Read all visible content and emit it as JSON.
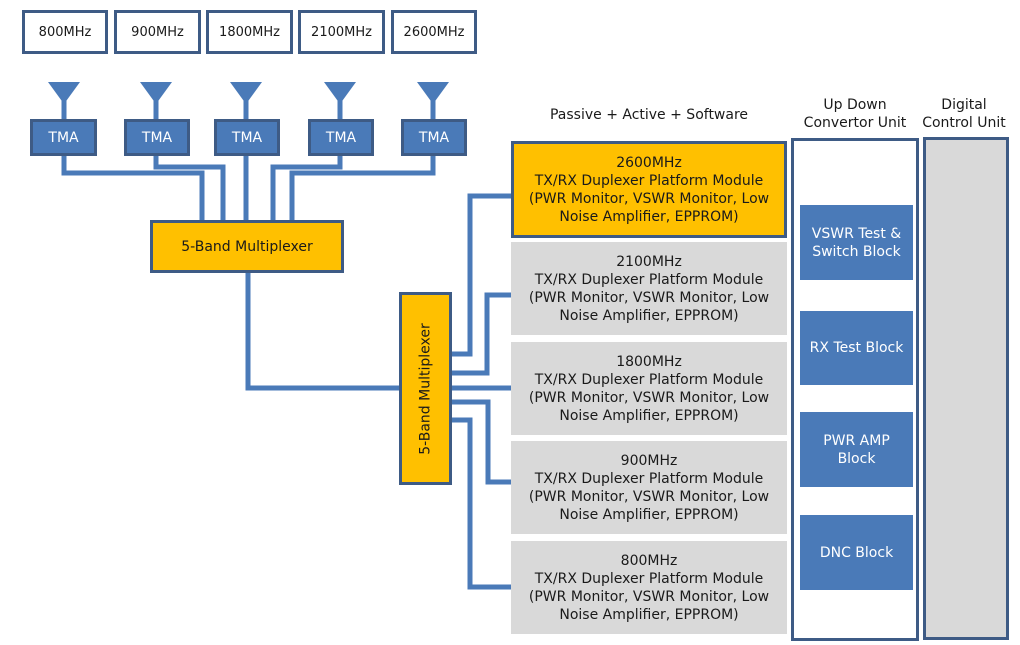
{
  "bands": [
    "800MHz",
    "900MHz",
    "1800MHz",
    "2100MHz",
    "2600MHz"
  ],
  "tma_label": "TMA",
  "multiplexer_top": "5-Band Multiplexer",
  "multiplexer_vertical": "5-Band Multiplexer",
  "section_header": "Passive + Active + Software",
  "modules": [
    {
      "freq": "2600MHz",
      "title": "TX/RX Duplexer Platform Module",
      "line1": "(PWR Monitor, VSWR Monitor, Low",
      "line2": "Noise Amplifier, EPPROM)",
      "highlight": true
    },
    {
      "freq": "2100MHz",
      "title": "TX/RX Duplexer Platform Module",
      "line1": "(PWR Monitor, VSWR Monitor, Low",
      "line2": "Noise Amplifier, EPPROM)",
      "highlight": false
    },
    {
      "freq": "1800MHz",
      "title": "TX/RX Duplexer Platform Module",
      "line1": "(PWR Monitor, VSWR Monitor, Low",
      "line2": "Noise Amplifier, EPPROM)",
      "highlight": false
    },
    {
      "freq": "900MHz",
      "title": "TX/RX Duplexer Platform Module",
      "line1": "(PWR Monitor, VSWR Monitor, Low",
      "line2": "Noise Amplifier, EPPROM)",
      "highlight": false
    },
    {
      "freq": "800MHz",
      "title": "TX/RX Duplexer Platform Module",
      "line1": "(PWR Monitor, VSWR Monitor, Low",
      "line2": "Noise Amplifier, EPPROM)",
      "highlight": false
    }
  ],
  "udc_unit": {
    "header_line1": "Up Down",
    "header_line2": "Convertor Unit",
    "blocks": [
      {
        "line1": "VSWR Test &",
        "line2": "Switch Block"
      },
      {
        "line1": "RX Test Block",
        "line2": ""
      },
      {
        "line1": "PWR AMP",
        "line2": "Block"
      },
      {
        "line1": "DNC Block",
        "line2": ""
      }
    ]
  },
  "dcu_unit": {
    "header_line1": "Digital",
    "header_line2": "Control Unit"
  },
  "colors": {
    "primary_blue": "#4a7ab8",
    "border_navy": "#3e5b85",
    "accent_yellow": "#ffc000",
    "module_gray": "#d9d9d9"
  }
}
